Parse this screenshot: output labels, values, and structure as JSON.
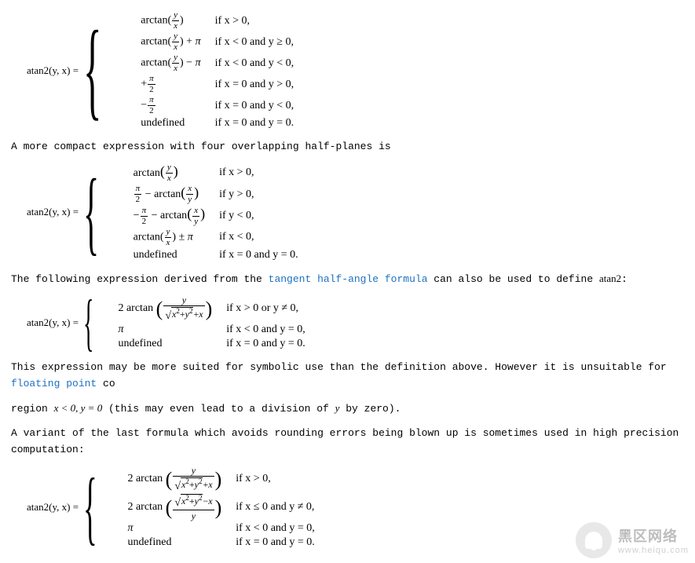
{
  "definitions": [
    {
      "lhs": "atan2(y, x) =",
      "brace_class": "h6",
      "cases": [
        {
          "expr": "arctan(y/x)",
          "cond": "if x > 0,"
        },
        {
          "expr": "arctan(y/x) + π",
          "cond": "if x < 0 and y ≥ 0,"
        },
        {
          "expr": "arctan(y/x) − π",
          "cond": "if x < 0 and y < 0,"
        },
        {
          "expr": "+π/2",
          "cond": "if x = 0 and y > 0,"
        },
        {
          "expr": "−π/2",
          "cond": "if x = 0 and y < 0,"
        },
        {
          "expr": "undefined",
          "cond": "if x = 0 and y = 0."
        }
      ]
    },
    {
      "lhs": "atan2(y, x) =",
      "brace_class": "h5",
      "cases": [
        {
          "expr": "arctan(y/x)",
          "cond": "if x > 0,"
        },
        {
          "expr": "π/2 − arctan(x/y)",
          "cond": "if y > 0,"
        },
        {
          "expr": "−π/2 − arctan(x/y)",
          "cond": "if y < 0,"
        },
        {
          "expr": "arctan(y/x) ± π",
          "cond": "if x < 0,"
        },
        {
          "expr": "undefined",
          "cond": "if x = 0 and y = 0."
        }
      ]
    },
    {
      "lhs": "atan2(y, x) =",
      "brace_class": "h3",
      "cases": [
        {
          "expr": "2 arctan( y / (√(x²+y²)+x) )",
          "cond": "if x > 0 or y ≠ 0,"
        },
        {
          "expr": "π",
          "cond": "if x < 0 and y = 0,"
        },
        {
          "expr": "undefined",
          "cond": "if x = 0 and y = 0."
        }
      ]
    },
    {
      "lhs": "atan2(y, x) =",
      "brace_class": "h4",
      "cases": [
        {
          "expr": "2 arctan( y / (√(x²+y²)+x) )",
          "cond": "if x > 0,"
        },
        {
          "expr": "2 arctan( (√(x²+y²) − x) / y )",
          "cond": "if x ≤ 0 and y ≠ 0,"
        },
        {
          "expr": "π",
          "cond": "if x < 0 and y = 0,"
        },
        {
          "expr": "undefined",
          "cond": "if x = 0 and y = 0."
        }
      ]
    }
  ],
  "paragraphs": {
    "p1": "A more compact expression with four overlapping half-planes is",
    "p2a": "The following expression derived from the ",
    "p2link": "tangent half-angle formula",
    "p2b": " can also be used to define ",
    "p2c": "atan2",
    "p2d": ":",
    "p3a": "This expression may be more suited for symbolic use than the definition above. However it is unsuitable for ",
    "p3link": "floating point",
    "p3b": " co",
    "p4a": "region ",
    "p4b": "x < 0, y = 0",
    "p4c": " (this may even lead to a division of ",
    "p4d": "y",
    "p4e": " by zero).",
    "p5": "A variant of the last formula which avoids rounding errors being blown up is sometimes used in high precision computation:"
  },
  "watermark": {
    "title": "黑区网络",
    "url": "www.heiqu.com"
  },
  "chart_data": {
    "type": "table",
    "note": "Piecewise definitions of atan2(y, x)",
    "definitions": [
      {
        "label": "primary",
        "rows": [
          {
            "value": "arctan(y/x)",
            "condition": "x > 0"
          },
          {
            "value": "arctan(y/x) + pi",
            "condition": "x < 0 and y >= 0"
          },
          {
            "value": "arctan(y/x) - pi",
            "condition": "x < 0 and y < 0"
          },
          {
            "value": "+pi/2",
            "condition": "x = 0 and y > 0"
          },
          {
            "value": "-pi/2",
            "condition": "x = 0 and y < 0"
          },
          {
            "value": "undefined",
            "condition": "x = 0 and y = 0"
          }
        ]
      },
      {
        "label": "four-half-planes",
        "rows": [
          {
            "value": "arctan(y/x)",
            "condition": "x > 0"
          },
          {
            "value": "pi/2 - arctan(x/y)",
            "condition": "y > 0"
          },
          {
            "value": "-pi/2 - arctan(x/y)",
            "condition": "y < 0"
          },
          {
            "value": "arctan(y/x) +/- pi",
            "condition": "x < 0"
          },
          {
            "value": "undefined",
            "condition": "x = 0 and y = 0"
          }
        ]
      },
      {
        "label": "tangent-half-angle",
        "rows": [
          {
            "value": "2*arctan( y / (sqrt(x^2+y^2)+x) )",
            "condition": "x > 0 or y != 0"
          },
          {
            "value": "pi",
            "condition": "x < 0 and y = 0"
          },
          {
            "value": "undefined",
            "condition": "x = 0 and y = 0"
          }
        ]
      },
      {
        "label": "high-precision-variant",
        "rows": [
          {
            "value": "2*arctan( y / (sqrt(x^2+y^2)+x) )",
            "condition": "x > 0"
          },
          {
            "value": "2*arctan( (sqrt(x^2+y^2)-x) / y )",
            "condition": "x <= 0 and y != 0"
          },
          {
            "value": "pi",
            "condition": "x < 0 and y = 0"
          },
          {
            "value": "undefined",
            "condition": "x = 0 and y = 0"
          }
        ]
      }
    ]
  }
}
